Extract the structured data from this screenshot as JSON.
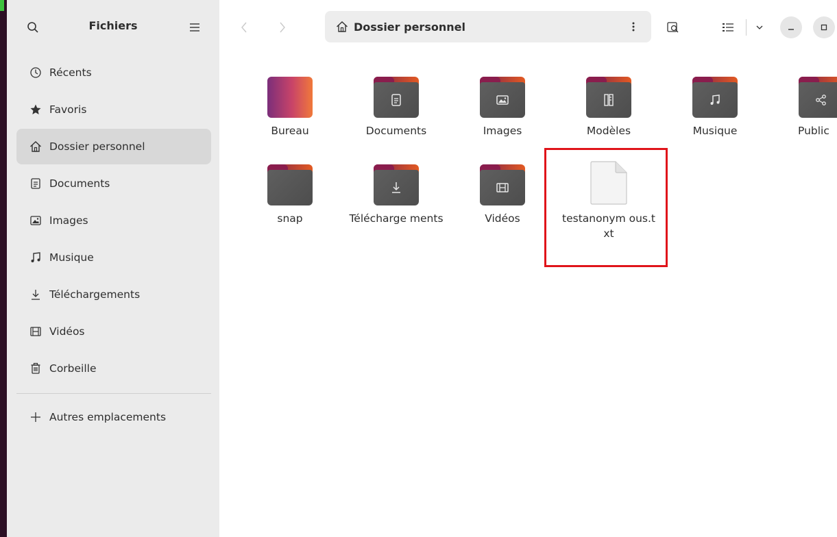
{
  "window": {
    "app_title": "Fichiers"
  },
  "colors": {
    "accent": "#e95420",
    "highlight": "#e0141a"
  },
  "sidebar": {
    "items": [
      {
        "label": "Récents",
        "icon": "clock-icon"
      },
      {
        "label": "Favoris",
        "icon": "star-icon"
      },
      {
        "label": "Dossier personnel",
        "icon": "home-icon",
        "active": true
      },
      {
        "label": "Documents",
        "icon": "document-icon"
      },
      {
        "label": "Images",
        "icon": "image-icon"
      },
      {
        "label": "Musique",
        "icon": "music-icon"
      },
      {
        "label": "Téléchargements",
        "icon": "download-icon"
      },
      {
        "label": "Vidéos",
        "icon": "film-icon"
      },
      {
        "label": "Corbeille",
        "icon": "trash-icon"
      }
    ],
    "other_locations": "Autres emplacements"
  },
  "header": {
    "path": "Dossier personnel"
  },
  "content": {
    "items": [
      {
        "label": "Bureau",
        "type": "folder"
      },
      {
        "label": "Documents",
        "type": "folder"
      },
      {
        "label": "Images",
        "type": "folder"
      },
      {
        "label": "Modèles",
        "type": "folder"
      },
      {
        "label": "Musique",
        "type": "folder"
      },
      {
        "label": "Public",
        "type": "folder"
      },
      {
        "label": "snap",
        "type": "folder"
      },
      {
        "label": "Télécharge ments",
        "type": "folder"
      },
      {
        "label": "Vidéos",
        "type": "folder"
      },
      {
        "label": "testanonym ous.txt",
        "type": "file"
      }
    ]
  }
}
